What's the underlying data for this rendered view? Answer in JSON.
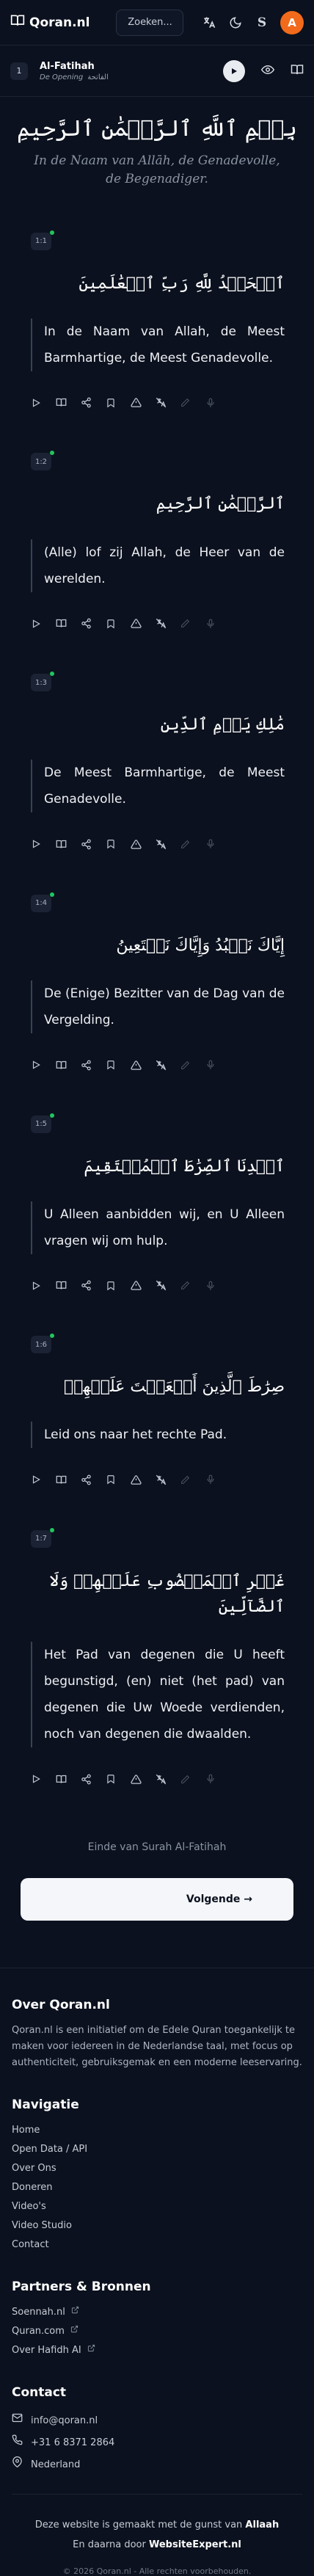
{
  "header": {
    "logo_text": "Qoran.nl",
    "search_label": "Zoeken...",
    "avatar_letter": "A",
    "s_label": "S"
  },
  "surah": {
    "number": "1",
    "name": "Al-Fatihah",
    "meaning": "De Opening",
    "arabic_name": "الفاتحة"
  },
  "bismillah": {
    "arabic": "بِسۡمِ ٱللَّهِ ٱلرَّحۡمَٰنِ ٱلرَّحِيمِ",
    "translation": "In de Naam van Allāh, de Genadevolle, de Begenadiger."
  },
  "verses": [
    {
      "badge": "1:1",
      "arabic": "ٱلۡحَمۡدُ لِلَّهِ رَبِّ ٱلۡعَٰلَمِينَ",
      "translation": "In de Naam van Allah, de Meest Barmhartige, de Meest Genadevolle."
    },
    {
      "badge": "1:2",
      "arabic": "ٱلرَّحۡمَٰنِ ٱلرَّحِيمِ",
      "translation": "(Alle) lof zij Allah, de Heer van de werelden."
    },
    {
      "badge": "1:3",
      "arabic": "مَٰلِكِ يَوۡمِ ٱلدِّينِ",
      "translation": "De Meest Barmhartige, de Meest Genadevolle."
    },
    {
      "badge": "1:4",
      "arabic": "إِيَّاكَ نَعۡبُدُ وَإِيَّاكَ نَسۡتَعِينُ",
      "translation": "De (Enige) Bezitter van de Dag van de Vergelding."
    },
    {
      "badge": "1:5",
      "arabic": "ٱهۡدِنَا ٱلصِّرَٰطَ ٱلۡمُسۡتَقِيمَ",
      "translation": "U Alleen aanbidden wij, en U Alleen vragen wij om hulp."
    },
    {
      "badge": "1:6",
      "arabic": "صِرَٰطَ ٱلَّذِينَ أَنۡعَمۡتَ عَلَيۡهِمۡ",
      "translation": "Leid ons naar het rechte Pad."
    },
    {
      "badge": "1:7",
      "arabic": "غَيۡرِ ٱلۡمَغۡضُوبِ عَلَيۡهِمۡ وَلَا ٱلضَّآلِّينَ",
      "translation": "Het Pad van degenen die U heeft begunstigd, (en) niet (het pad) van degenen die Uw Woede verdienden, noch van degenen die dwaalden."
    }
  ],
  "end_note": "Einde van Surah Al-Fatihah",
  "next_label": "Volgende →",
  "footer": {
    "about_title": "Over Qoran.nl",
    "about_text": "Qoran.nl is een initiatief om de Edele Quran toegankelijk te maken voor iedereen in de Nederlandse taal, met focus op authenticiteit, gebruiksgemak en een moderne leeservaring.",
    "nav_title": "Navigatie",
    "nav_items": [
      "Home",
      "Open Data / API",
      "Over Ons",
      "Doneren",
      "Video's",
      "Video Studio",
      "Contact"
    ],
    "partners_title": "Partners & Bronnen",
    "partners": [
      "Soennah.nl",
      "Quran.com",
      "Over Hafidh AI"
    ],
    "contact_title": "Contact",
    "email": "info@qoran.nl",
    "phone": "+31 6 8371 2864",
    "location": "Nederland",
    "made_prefix": "Deze website is gemaakt met de gunst van",
    "made_allah": "Allaah",
    "dev_prefix": "En daarna door",
    "dev_name": "WebsiteExpert.nl",
    "copyright": "© 2026 Qoran.nl - Alle rechten voorbehouden."
  }
}
